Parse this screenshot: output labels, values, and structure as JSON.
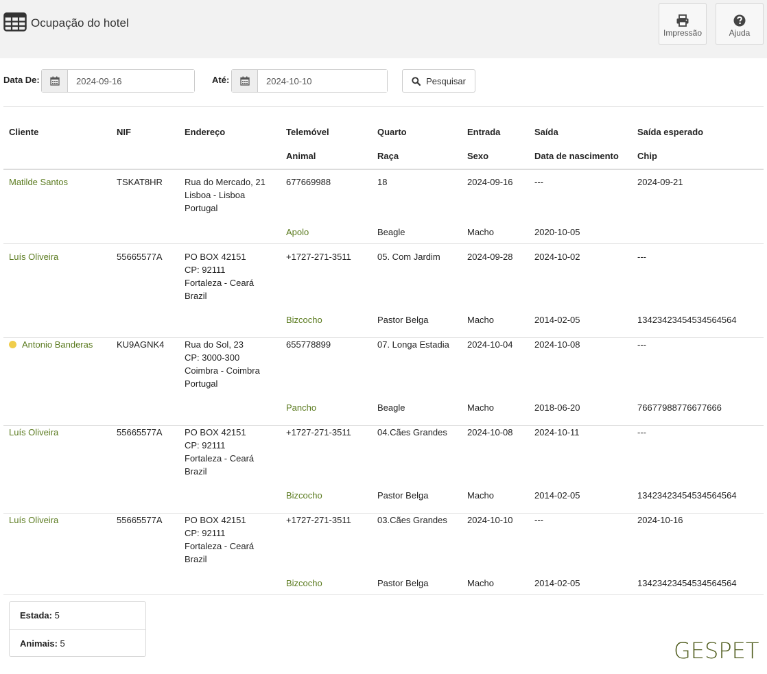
{
  "header": {
    "title": "Ocupação do hotel",
    "buttons": {
      "print": "Impressão",
      "help": "Ajuda"
    }
  },
  "filters": {
    "from_label": "Data De:",
    "from_value": "2024-09-16",
    "to_label": "Até:",
    "to_value": "2024-10-10",
    "search_label": "Pesquisar"
  },
  "table": {
    "headers_row1": [
      "Cliente",
      "NIF",
      "Endereço",
      "Telemóvel",
      "Quarto",
      "Entrada",
      "Saída",
      "Saída esperado"
    ],
    "headers_row2": [
      "Animal",
      "Raça",
      "Sexo",
      "Data de nascimento",
      "Chip"
    ],
    "rows": [
      {
        "client": "Matilde Santos",
        "flag": false,
        "nif": "TSKAT8HR",
        "address": [
          "Rua do Mercado, 21",
          "Lisboa - Lisboa",
          "Portugal"
        ],
        "phone": "677669988",
        "room": "18",
        "checkin": "2024-09-16",
        "checkout": "---",
        "expected": "2024-09-21",
        "animal": "Apolo",
        "breed": "Beagle",
        "sex": "Macho",
        "birth": "2020-10-05",
        "chip": ""
      },
      {
        "client": "Luís Oliveira",
        "flag": false,
        "nif": "55665577A",
        "address": [
          "PO BOX 42151",
          "CP: 92111",
          "Fortaleza - Ceará",
          "Brazil"
        ],
        "phone": "+1727-271-3511",
        "room": "05. Com Jardim",
        "checkin": "2024-09-28",
        "checkout": "2024-10-02",
        "expected": "---",
        "animal": "Bizcocho",
        "breed": "Pastor Belga",
        "sex": "Macho",
        "birth": "2014-02-05",
        "chip": "13423423454534564564"
      },
      {
        "client": "Antonio Banderas",
        "flag": true,
        "nif": "KU9AGNK4",
        "address": [
          "Rua do Sol, 23",
          "CP: 3000-300",
          "Coimbra - Coimbra",
          "Portugal"
        ],
        "phone": "655778899",
        "room": "07. Longa Estadia",
        "checkin": "2024-10-04",
        "checkout": "2024-10-08",
        "expected": "---",
        "animal": "Pancho",
        "breed": "Beagle",
        "sex": "Macho",
        "birth": "2018-06-20",
        "chip": "76677988776677666"
      },
      {
        "client": "Luís Oliveira",
        "flag": false,
        "nif": "55665577A",
        "address": [
          "PO BOX 42151",
          "CP: 92111",
          "Fortaleza - Ceará",
          "Brazil"
        ],
        "phone": "+1727-271-3511",
        "room": "04.Cães Grandes",
        "checkin": "2024-10-08",
        "checkout": "2024-10-11",
        "expected": "---",
        "animal": "Bizcocho",
        "breed": "Pastor Belga",
        "sex": "Macho",
        "birth": "2014-02-05",
        "chip": "13423423454534564564"
      },
      {
        "client": "Luís Oliveira",
        "flag": false,
        "nif": "55665577A",
        "address": [
          "PO BOX 42151",
          "CP: 92111",
          "Fortaleza - Ceará",
          "Brazil"
        ],
        "phone": "+1727-271-3511",
        "room": "03.Cães Grandes",
        "checkin": "2024-10-10",
        "checkout": "---",
        "expected": "2024-10-16",
        "animal": "Bizcocho",
        "breed": "Pastor Belga",
        "sex": "Macho",
        "birth": "2014-02-05",
        "chip": "13423423454534564564"
      }
    ]
  },
  "summary": {
    "stays_label": "Estada:",
    "stays_value": "5",
    "animals_label": "Animais:",
    "animals_value": "5"
  },
  "brand": "GESPET",
  "colors": {
    "link": "#5a7a1e",
    "flag_dot": "#f0cd4b",
    "brand": "#4d5a1a",
    "header_bg": "#f2f2f2"
  }
}
